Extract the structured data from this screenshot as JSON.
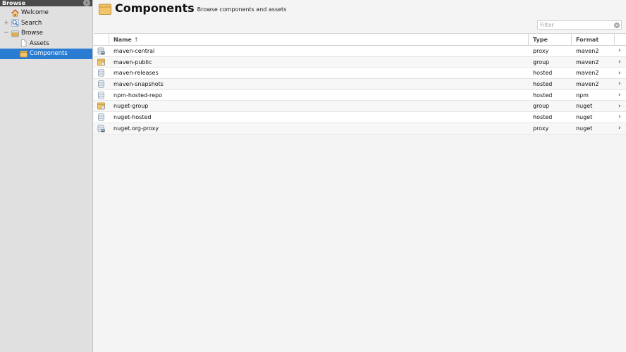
{
  "sidebar": {
    "header": "Browse",
    "items": [
      {
        "label": "Welcome",
        "icon": "house-icon",
        "expander": ""
      },
      {
        "label": "Search",
        "icon": "magnifier-icon",
        "expander": "+"
      },
      {
        "label": "Browse",
        "icon": "browse-folder-icon",
        "expander": "−"
      },
      {
        "label": "Assets",
        "icon": "document-icon",
        "expander": ""
      },
      {
        "label": "Components",
        "icon": "folder-icon",
        "expander": "",
        "selected": true
      }
    ]
  },
  "header": {
    "title": "Components",
    "subtitle": "Browse components and assets"
  },
  "filter": {
    "placeholder": "Filter"
  },
  "grid": {
    "columns": {
      "name": "Name",
      "type": "Type",
      "format": "Format"
    },
    "rows": [
      {
        "name": "maven-central",
        "type": "proxy",
        "format": "maven2",
        "icon": "proxy-repo-icon"
      },
      {
        "name": "maven-public",
        "type": "group",
        "format": "maven2",
        "icon": "group-repo-icon"
      },
      {
        "name": "maven-releases",
        "type": "hosted",
        "format": "maven2",
        "icon": "hosted-repo-icon"
      },
      {
        "name": "maven-snapshots",
        "type": "hosted",
        "format": "maven2",
        "icon": "hosted-repo-icon"
      },
      {
        "name": "npm-hosted-repo",
        "type": "hosted",
        "format": "npm",
        "icon": "hosted-repo-icon"
      },
      {
        "name": "nuget-group",
        "type": "group",
        "format": "nuget",
        "icon": "group-repo-icon"
      },
      {
        "name": "nuget-hosted",
        "type": "hosted",
        "format": "nuget",
        "icon": "hosted-repo-icon"
      },
      {
        "name": "nuget.org-proxy",
        "type": "proxy",
        "format": "nuget",
        "icon": "proxy-repo-icon"
      }
    ]
  },
  "colors": {
    "selected": "#2a7cd3",
    "sidebar_header": "#4b4b4b",
    "folder": "#e8b04a"
  }
}
